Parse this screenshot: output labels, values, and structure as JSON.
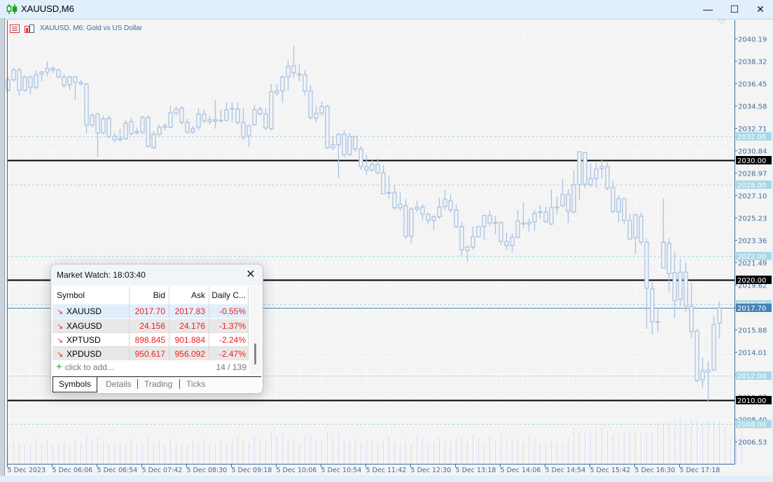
{
  "window": {
    "title": "XAUUSD,M6",
    "controls": {
      "minimize": "—",
      "maximize": "☐",
      "close": "✕"
    }
  },
  "chart": {
    "caption": "XAUUSD, M6:  Gold vs US Dollar",
    "colors": {
      "candle": "#a9c3e3",
      "volume": "#dcdcf5",
      "grid": "#ffffff",
      "axis": "#3a6ea5",
      "level_line": "#000000",
      "dashed_level": "#9fd5e6",
      "bid": "#4682b4",
      "background": "#f4f4f4"
    }
  },
  "chart_data": {
    "type": "candlestick",
    "symbol": "XAUUSD",
    "timeframe": "M6",
    "ylim": [
      2005.6,
      2041.8
    ],
    "price_ticks": [
      "2040.19",
      "2038.32",
      "2036.45",
      "2034.58",
      "2032.71",
      "2030.84",
      "2028.97",
      "2027.10",
      "2025.23",
      "2023.36",
      "2021.49",
      "2019.62",
      "2017.75",
      "2015.88",
      "2014.01",
      "2012.14",
      "2010.27",
      "2008.40",
      "2006.53"
    ],
    "time_ticks": [
      "5 Dec 2023",
      "5 Dec 06:06",
      "5 Dec 06:54",
      "5 Dec 07:42",
      "5 Dec 08:30",
      "5 Dec 09:18",
      "5 Dec 10:06",
      "5 Dec 10:54",
      "5 Dec 11:42",
      "5 Dec 12:30",
      "5 Dec 13:18",
      "5 Dec 14:06",
      "5 Dec 14:54",
      "5 Dec 15:42",
      "5 Dec 16:30",
      "5 Dec 17:18"
    ],
    "solid_levels": [
      "2030.00",
      "2020.00",
      "2010.00"
    ],
    "dashed_levels": [
      "2032.00",
      "2028.00",
      "2022.00",
      "2018.00",
      "2012.00",
      "2008.00"
    ],
    "bid": "2017.70",
    "ohlc": [
      [
        2035.86,
        2036.98,
        2035.75,
        2036.74
      ],
      [
        2036.74,
        2037.74,
        2036.62,
        2037.56
      ],
      [
        2037.56,
        2037.74,
        2035.4,
        2035.86
      ],
      [
        2035.86,
        2037.09,
        2035.75,
        2036.98
      ],
      [
        2036.98,
        2037.09,
        2035.51,
        2036.1
      ],
      [
        2036.1,
        2037.5,
        2035.98,
        2037.15
      ],
      [
        2037.21,
        2037.5,
        2036.57,
        2037.38
      ],
      [
        2037.38,
        2038.32,
        2037.03,
        2037.68
      ],
      [
        2037.68,
        2037.85,
        2037.33,
        2037.56
      ],
      [
        2037.56,
        2037.68,
        2036.86,
        2036.98
      ],
      [
        2036.98,
        2037.21,
        2036.1,
        2036.27
      ],
      [
        2036.33,
        2037.09,
        2035.86,
        2036.98
      ],
      [
        2036.98,
        2037.09,
        2035.05,
        2036.51
      ],
      [
        2036.51,
        2036.74,
        2036.27,
        2036.39
      ],
      [
        2036.39,
        2036.51,
        2032.24,
        2032.95
      ],
      [
        2032.95,
        2033.94,
        2032.77,
        2033.76
      ],
      [
        2033.88,
        2033.99,
        2030.25,
        2032.3
      ],
      [
        2032.3,
        2033.76,
        2032.18,
        2033.47
      ],
      [
        2033.53,
        2033.76,
        2031.83,
        2032.01
      ],
      [
        2032.01,
        2032.3,
        2031.49,
        2031.72
      ],
      [
        2031.72,
        2032.65,
        2031.6,
        2031.83
      ],
      [
        2031.83,
        2033.35,
        2031.72,
        2033.12
      ],
      [
        2033.24,
        2033.59,
        2032.07,
        2032.24
      ],
      [
        2032.3,
        2032.77,
        2032.18,
        2032.42
      ],
      [
        2032.36,
        2033.76,
        2032.18,
        2033.59
      ],
      [
        2033.59,
        2033.76,
        2031.07,
        2031.19
      ],
      [
        2031.07,
        2032.42,
        2030.95,
        2032.18
      ],
      [
        2032.18,
        2033.0,
        2032.07,
        2032.77
      ],
      [
        2032.77,
        2033.12,
        2032.53,
        2032.89
      ],
      [
        2032.77,
        2034.58,
        2032.65,
        2033.99
      ],
      [
        2033.94,
        2034.52,
        2033.76,
        2034.29
      ],
      [
        2034.4,
        2034.52,
        2033.0,
        2033.18
      ],
      [
        2033.18,
        2033.47,
        2032.24,
        2032.36
      ],
      [
        2032.36,
        2032.89,
        2032.24,
        2032.65
      ],
      [
        2032.77,
        2034.34,
        2032.53,
        2033.88
      ],
      [
        2033.88,
        2034.23,
        2033.12,
        2033.29
      ],
      [
        2033.24,
        2033.76,
        2033.0,
        2033.41
      ],
      [
        2033.41,
        2035.05,
        2032.65,
        2033.29
      ],
      [
        2033.29,
        2034.23,
        2033.18,
        2033.35
      ],
      [
        2033.35,
        2034.87,
        2033.24,
        2034.23
      ],
      [
        2034.29,
        2034.87,
        2033.18,
        2034.34
      ],
      [
        2034.29,
        2034.87,
        2033.0,
        2033.18
      ],
      [
        2033.18,
        2034.34,
        2031.72,
        2031.95
      ],
      [
        2032.07,
        2033.0,
        2031.13,
        2032.89
      ],
      [
        2033.0,
        2034.64,
        2032.89,
        2034.23
      ],
      [
        2033.88,
        2034.52,
        2033.76,
        2034.29
      ],
      [
        2033.88,
        2034.34,
        2032.53,
        2032.71
      ],
      [
        2032.65,
        2036.39,
        2032.53,
        2035.75
      ],
      [
        2035.63,
        2036.39,
        2035.4,
        2035.81
      ],
      [
        2035.81,
        2037.09,
        2034.81,
        2036.98
      ],
      [
        2036.98,
        2038.38,
        2035.81,
        2037.85
      ],
      [
        2037.91,
        2039.61,
        2036.92,
        2037.33
      ],
      [
        2037.21,
        2038.03,
        2036.62,
        2037.15
      ],
      [
        2037.15,
        2037.56,
        2035.4,
        2035.81
      ],
      [
        2035.81,
        2036.33,
        2033.41,
        2033.59
      ],
      [
        2033.53,
        2034.58,
        2033.18,
        2033.94
      ],
      [
        2033.94,
        2034.93,
        2033.76,
        2034.52
      ],
      [
        2034.52,
        2034.64,
        2030.95,
        2031.07
      ],
      [
        2031.07,
        2032.07,
        2030.84,
        2031.31
      ],
      [
        2031.31,
        2032.3,
        2028.56,
        2032.18
      ],
      [
        2032.18,
        2032.53,
        2030.25,
        2030.49
      ],
      [
        2030.49,
        2032.3,
        2030.37,
        2032.01
      ],
      [
        2032.01,
        2032.07,
        2030.72,
        2030.95
      ],
      [
        2030.95,
        2031.19,
        2029.2,
        2029.49
      ],
      [
        2029.49,
        2030.49,
        2028.79,
        2029.2
      ],
      [
        2029.2,
        2030.08,
        2029.08,
        2029.67
      ],
      [
        2029.67,
        2030.2,
        2028.79,
        2028.97
      ],
      [
        2028.97,
        2029.61,
        2027.16,
        2027.21
      ],
      [
        2027.27,
        2028.67,
        2026.81,
        2027.33
      ],
      [
        2027.33,
        2027.91,
        2025.87,
        2026.05
      ],
      [
        2026.05,
        2027.33,
        2025.75,
        2026.34
      ],
      [
        2026.22,
        2026.75,
        2023.42,
        2023.65
      ],
      [
        2023.65,
        2026.1,
        2023.07,
        2025.93
      ],
      [
        2025.93,
        2026.63,
        2025.7,
        2026.1
      ],
      [
        2026.1,
        2026.34,
        2024.99,
        2025.52
      ],
      [
        2025.52,
        2025.64,
        2024.64,
        2024.99
      ],
      [
        2024.99,
        2025.46,
        2024.17,
        2025.29
      ],
      [
        2025.29,
        2026.87,
        2025.11,
        2026.1
      ],
      [
        2026.16,
        2027.56,
        2025.87,
        2026.75
      ],
      [
        2026.63,
        2027.16,
        2025.64,
        2025.87
      ],
      [
        2025.87,
        2026.34,
        2024.35,
        2024.47
      ],
      [
        2024.47,
        2024.88,
        2022.01,
        2022.54
      ],
      [
        2022.48,
        2022.89,
        2021.55,
        2022.77
      ],
      [
        2022.77,
        2024.47,
        2022.54,
        2023.65
      ],
      [
        2023.65,
        2024.47,
        2023.53,
        2024.47
      ],
      [
        2024.47,
        2025.46,
        2023.36,
        2025.4
      ],
      [
        2025.4,
        2025.81,
        2024.53,
        2024.76
      ],
      [
        2024.76,
        2025.4,
        2023.83,
        2024.82
      ],
      [
        2024.82,
        2024.88,
        2022.95,
        2023.24
      ],
      [
        2023.24,
        2023.94,
        2022.54,
        2022.89
      ],
      [
        2022.89,
        2023.88,
        2022.31,
        2023.59
      ],
      [
        2023.59,
        2025.87,
        2023.47,
        2024.94
      ],
      [
        2024.76,
        2026.51,
        2024.35,
        2024.7
      ],
      [
        2024.7,
        2025.17,
        2024.06,
        2024.82
      ],
      [
        2024.88,
        2025.87,
        2024.12,
        2025.58
      ],
      [
        2025.64,
        2026.28,
        2025.11,
        2025.7
      ],
      [
        2025.7,
        2026.16,
        2024.76,
        2024.88
      ],
      [
        2024.7,
        2027.56,
        2024.58,
        2026.05
      ],
      [
        2026.05,
        2026.98,
        2025.46,
        2026.1
      ],
      [
        2026.22,
        2028.44,
        2026.1,
        2027.16
      ],
      [
        2027.16,
        2027.62,
        2024.76,
        2025.75
      ],
      [
        2025.7,
        2029.14,
        2025.58,
        2027.97
      ],
      [
        2027.97,
        2030.78,
        2026.69,
        2030.72
      ],
      [
        2030.66,
        2030.72,
        2027.68,
        2028.03
      ],
      [
        2027.97,
        2029.73,
        2027.74,
        2028.5
      ],
      [
        2028.5,
        2029.79,
        2027.74,
        2029.26
      ],
      [
        2029.32,
        2030.14,
        2028.5,
        2029.49
      ],
      [
        2029.49,
        2029.96,
        2027.5,
        2027.68
      ],
      [
        2027.74,
        2028.32,
        2025.58,
        2025.75
      ],
      [
        2025.7,
        2027.1,
        2024.82,
        2026.81
      ],
      [
        2026.81,
        2026.87,
        2024.7,
        2024.99
      ],
      [
        2024.99,
        2025.52,
        2023.42,
        2023.42
      ],
      [
        2023.53,
        2025.58,
        2022.19,
        2025.46
      ],
      [
        2025.34,
        2025.64,
        2022.95,
        2023.18
      ],
      [
        2023.18,
        2023.47,
        2015.93,
        2019.32
      ],
      [
        2019.27,
        2019.85,
        2015.47,
        2016.52
      ],
      [
        2016.52,
        2017.57,
        2015.64,
        2016.52
      ],
      [
        2021.02,
        2026.81,
        2021.02,
        2023.18
      ],
      [
        2023.07,
        2023.47,
        2019.03,
        2020.55
      ],
      [
        2020.61,
        2022.36,
        2016.81,
        2018.27
      ],
      [
        2018.39,
        2021.78,
        2017.8,
        2020.67
      ],
      [
        2020.67,
        2021.49,
        2017.34,
        2017.86
      ],
      [
        2017.8,
        2019.79,
        2015.12,
        2015.7
      ],
      [
        2015.76,
        2015.93,
        2011.49,
        2011.61
      ],
      [
        2011.67,
        2013.54,
        2010.97,
        2012.43
      ],
      [
        2012.49,
        2013.25,
        2009.8,
        2012.31
      ],
      [
        2012.49,
        2016.98,
        2012.49,
        2016.28
      ],
      [
        2016.4,
        2018.21,
        2015.12,
        2017.7
      ]
    ],
    "tick_volume": [
      90,
      110,
      100,
      95,
      105,
      120,
      100,
      115,
      90,
      100,
      110,
      95,
      120,
      100,
      140,
      110,
      130,
      105,
      95,
      100,
      110,
      100,
      120,
      95,
      105,
      130,
      100,
      110,
      95,
      120,
      105,
      100,
      95,
      110,
      100,
      120,
      105,
      95,
      110,
      100,
      120,
      130,
      110,
      100,
      140,
      120,
      115,
      150,
      130,
      140,
      110,
      120,
      100,
      130,
      145,
      110,
      120,
      150,
      125,
      140,
      115,
      105,
      120,
      100,
      115,
      110,
      100,
      110,
      135,
      110,
      95,
      120,
      100,
      130,
      120,
      105,
      110,
      125,
      110,
      115,
      120,
      125,
      110,
      140,
      120,
      100,
      130,
      110,
      150,
      120,
      125,
      115,
      110,
      130,
      120,
      100,
      105,
      110,
      100,
      105,
      130,
      170,
      150,
      150,
      160,
      160,
      170,
      160,
      140,
      135,
      150,
      155,
      155,
      150,
      145,
      150,
      195,
      190,
      200,
      215,
      235,
      210,
      215,
      210,
      200,
      210,
      205,
      210,
      180,
      125,
      130,
      160
    ]
  },
  "market_watch": {
    "title": "Market Watch: 18:03:40",
    "close": "✕",
    "columns": [
      "Symbol",
      "Bid",
      "Ask",
      "Daily C..."
    ],
    "rows": [
      {
        "symbol": "XAUUSD",
        "bid": "2017.70",
        "ask": "2017.83",
        "change": "-0.55%"
      },
      {
        "symbol": "XAGUSD",
        "bid": "24.156",
        "ask": "24.176",
        "change": "-1.37%"
      },
      {
        "symbol": "XPTUSD",
        "bid": "898.845",
        "ask": "901.884",
        "change": "-2.24%"
      },
      {
        "symbol": "XPDUSD",
        "bid": "950.617",
        "ask": "956.092",
        "change": "-2.47%"
      }
    ],
    "add_label": "click to add...",
    "count": "14 / 139",
    "tabs": [
      "Symbols",
      "Details",
      "Trading",
      "Ticks"
    ],
    "active_tab": "Symbols"
  }
}
